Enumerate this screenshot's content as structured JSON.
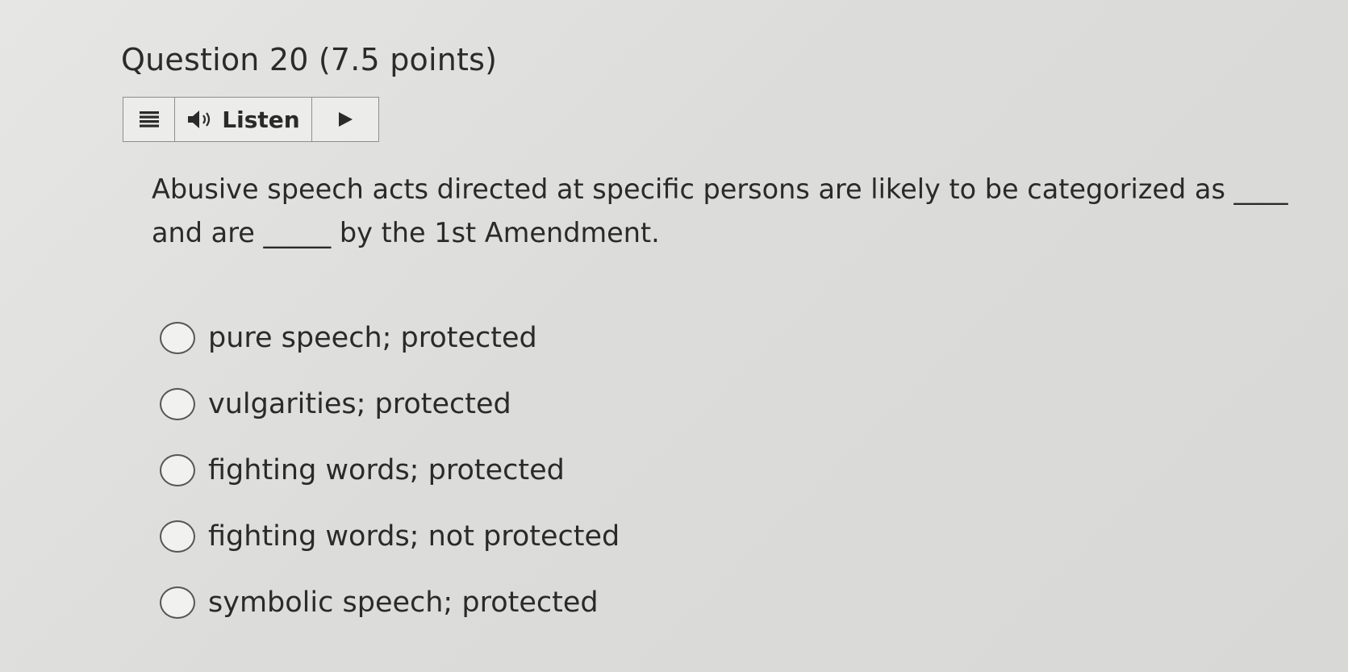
{
  "question": {
    "title": "Question 20 (7.5 points)",
    "text_line1": "Abusive speech acts directed at specific persons are likely to be categorized as ____",
    "text_line2": "and are _____ by the 1st Amendment."
  },
  "toolbar": {
    "menu_icon": "menu-icon",
    "listen_icon": "speaker-icon",
    "listen_label": "Listen",
    "play_icon": "play-icon"
  },
  "options": [
    {
      "label": "pure speech; protected",
      "selected": false
    },
    {
      "label": "vulgarities; protected",
      "selected": false
    },
    {
      "label": "fighting words; protected",
      "selected": false
    },
    {
      "label": "fighting words; not protected",
      "selected": false
    },
    {
      "label": "symbolic speech; protected",
      "selected": false
    }
  ]
}
